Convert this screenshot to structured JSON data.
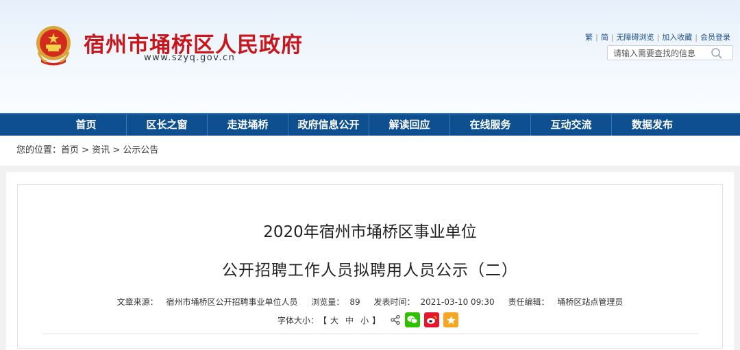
{
  "header": {
    "title": "宿州市埇桥区人民政府",
    "url": "www.szyq.gov.cn",
    "links": [
      "繁",
      "简",
      "无障碍浏览",
      "加入收藏",
      "会员登录"
    ],
    "search_placeholder": "请输入需要查找的信息"
  },
  "nav": {
    "items": [
      "首页",
      "区长之窗",
      "走进埇桥",
      "政府信息公开",
      "解读回应",
      "在线服务",
      "互动交流",
      "数据发布"
    ]
  },
  "breadcrumb": {
    "prefix": "您的位置：",
    "items": [
      "首页",
      "资讯",
      "公示公告"
    ]
  },
  "article": {
    "title_line1": "2020年宿州市埇桥区事业单位",
    "title_line2": "公开招聘工作人员拟聘用人员公示（二）",
    "source_label": "文章来源：",
    "source": "宿州市埇桥区公开招聘事业单位人员",
    "views_label": "浏览量：",
    "views": "89",
    "date_label": "发表时间：",
    "date": "2021-03-10 09:30",
    "editor_label": "责任编辑：",
    "editor": "埇桥区站点管理员",
    "font_size_label": "字体大小：",
    "font_sizes": [
      "大",
      "中",
      "小"
    ],
    "bracket_open": "【",
    "bracket_close": "】"
  },
  "colors": {
    "title_red": "#c8161d",
    "nav_blue": "#0d4f8f",
    "wechat": "#2dc100",
    "weibo": "#e6162d",
    "favorite": "#f5a623"
  },
  "icons": {
    "share": "share-icon",
    "wechat": "wechat-icon",
    "weibo": "weibo-icon",
    "favorite": "star-icon",
    "search": "search-icon",
    "emblem": "national-emblem-icon"
  }
}
